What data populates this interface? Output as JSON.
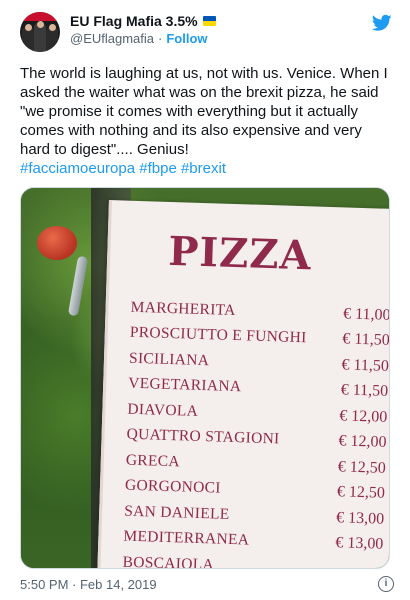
{
  "author": {
    "name": "EU Flag Mafia 3.5%",
    "handle": "@EUflagmafia",
    "separator": "·",
    "follow_label": "Follow",
    "badge_icon": "ukraine-flag-icon"
  },
  "brand_icon": "twitter-bird-icon",
  "tweet": {
    "text": "The world is laughing at us, not with us. Venice. When I asked the waiter what was on the brexit pizza, he said \"we promise it comes with everything but it actually comes with nothing and its also expensive and very hard to digest\".... Genius!",
    "hashtags": [
      "#facciamoeuropa",
      "#fbpe",
      "#brexit"
    ]
  },
  "photo": {
    "sign_title": "PIZZA",
    "menu": [
      {
        "name": "MARGHERITA",
        "price": "€ 11,00"
      },
      {
        "name": "PROSCIUTTO E FUNGHI",
        "price": "€ 11,50"
      },
      {
        "name": "SICILIANA",
        "price": "€ 11,50"
      },
      {
        "name": "VEGETARIANA",
        "price": "€ 11,50"
      },
      {
        "name": "DIAVOLA",
        "price": "€ 12,00"
      },
      {
        "name": "QUATTRO STAGIONI",
        "price": "€ 12,00"
      },
      {
        "name": "GRECA",
        "price": "€ 12,50"
      },
      {
        "name": "GORGONOCI",
        "price": "€ 12,50"
      },
      {
        "name": "SAN DANIELE",
        "price": "€ 13,00"
      },
      {
        "name": "MEDITERRANEA",
        "price": "€ 13,00"
      },
      {
        "name": "BOSCAIOLA",
        "price": ""
      }
    ]
  },
  "footer": {
    "timestamp": "5:50 PM · Feb 14, 2019",
    "info_icon": "info-icon"
  },
  "colors": {
    "link": "#1d9bf0",
    "secondary_text": "#536471",
    "sign_text": "#8f2a4d"
  }
}
